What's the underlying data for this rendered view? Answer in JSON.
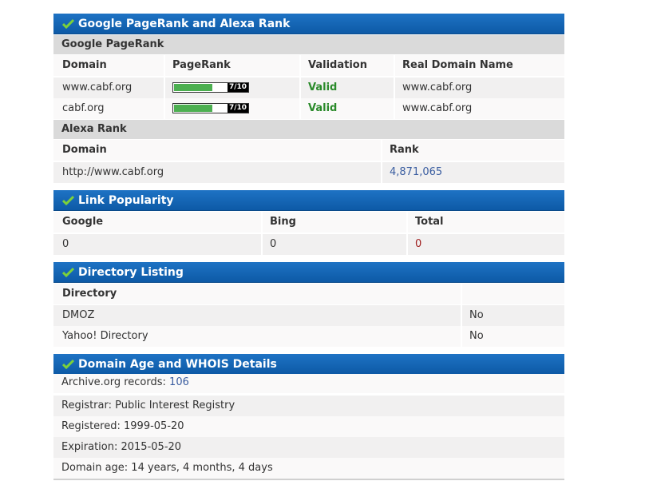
{
  "pagerank_section": {
    "title": "Google PageRank and Alexa Rank",
    "google_subhead": "Google PageRank",
    "columns": [
      "Domain",
      "PageRank",
      "Validation",
      "Real Domain Name"
    ],
    "rows": [
      {
        "domain": "www.cabf.org",
        "pagerank": "7/10",
        "pagerank_fraction": 0.7,
        "validation": "Valid",
        "real_domain": "www.cabf.org"
      },
      {
        "domain": "cabf.org",
        "pagerank": "7/10",
        "pagerank_fraction": 0.7,
        "validation": "Valid",
        "real_domain": "www.cabf.org"
      }
    ],
    "alexa_subhead": "Alexa Rank",
    "alexa_columns": [
      "Domain",
      "Rank"
    ],
    "alexa_row": {
      "domain": "http://www.cabf.org",
      "rank": "4,871,065"
    }
  },
  "link_popularity": {
    "title": "Link Popularity",
    "columns": [
      "Google",
      "Bing",
      "Total"
    ],
    "values": [
      "0",
      "0",
      "0"
    ]
  },
  "directory_listing": {
    "title": "Directory Listing",
    "column": "Directory",
    "rows": [
      {
        "name": "DMOZ",
        "value": "No"
      },
      {
        "name": "Yahoo! Directory",
        "value": "No"
      }
    ]
  },
  "domain_age": {
    "title": "Domain Age and WHOIS Details",
    "archive_label": "Archive.org records: ",
    "archive_value": "106",
    "registrar": "Registrar: Public Interest Registry",
    "registered": "Registered: 1999-05-20",
    "expiration": "Expiration: 2015-05-20",
    "age": "Domain age: 14 years, 4 months, 4 days"
  },
  "icons": {
    "section_check": "check-icon"
  },
  "colors": {
    "header_blue": "#1565b8",
    "valid_green": "#2a8a2a",
    "link_blue": "#3a5da0",
    "pagerank_green": "#4caf50"
  }
}
